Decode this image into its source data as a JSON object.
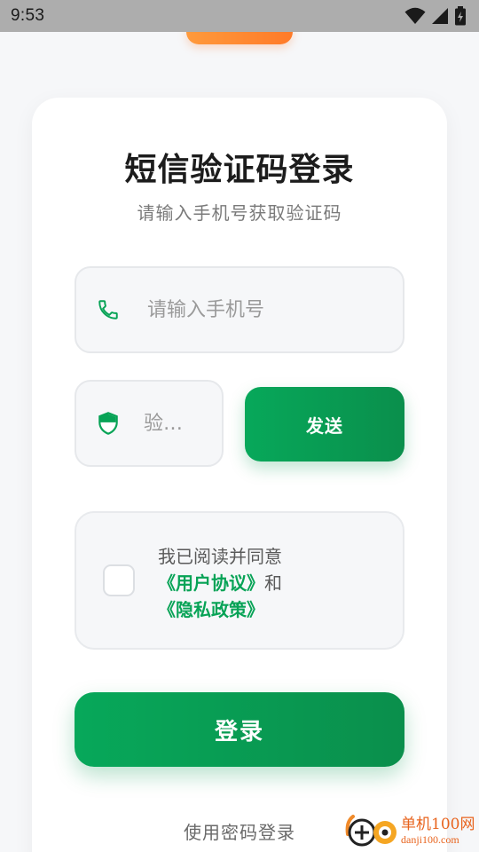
{
  "status_bar": {
    "time": "9:53"
  },
  "top_pill": {
    "label": ""
  },
  "header": {
    "title": "短信验证码登录",
    "subtitle": "请输入手机号获取验证码"
  },
  "phone": {
    "placeholder": "请输入手机号",
    "icon": "phone-icon"
  },
  "code": {
    "placeholder": "验…",
    "icon": "shield-icon"
  },
  "send_button": {
    "label": "发送"
  },
  "agreement": {
    "prefix": "我已阅读并同意",
    "user_agreement": "《用户协议》",
    "and": "和",
    "privacy_policy": "《隐私政策》",
    "checked": false
  },
  "login_button": {
    "label": "登录"
  },
  "password_login": {
    "label": "使用密码登录"
  },
  "watermark": {
    "cn": "单机100网",
    "en": "danji100.com"
  },
  "colors": {
    "accent": "#07a356",
    "accent_dark": "#0a8f4c",
    "orange": "#ff7a28",
    "status_bar": "#adadad"
  }
}
